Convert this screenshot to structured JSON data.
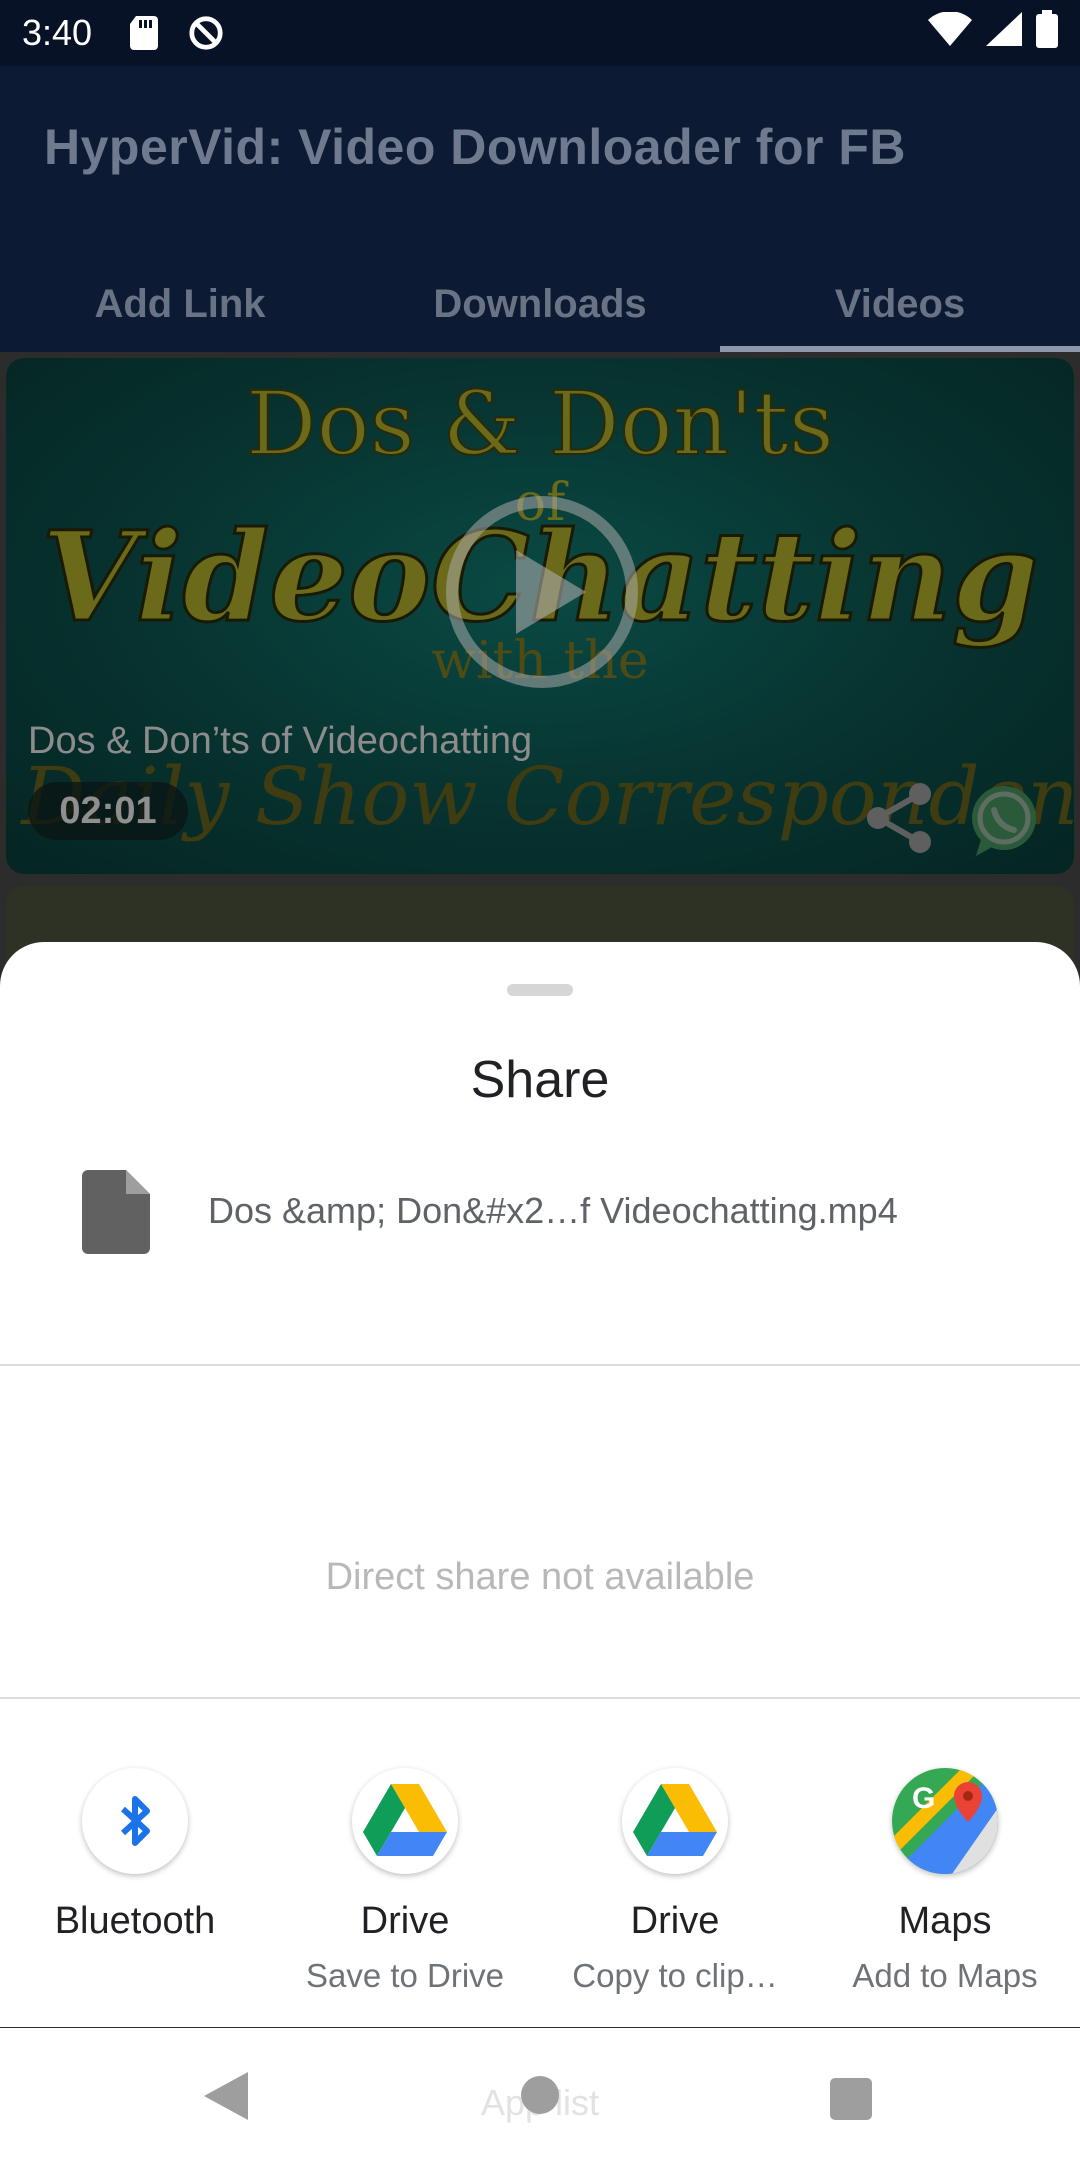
{
  "status_bar": {
    "time": "3:40",
    "icons_left": [
      "sd-card-icon",
      "vpn-icon"
    ],
    "icons_right": [
      "wifi-icon",
      "signal-icon",
      "battery-icon"
    ]
  },
  "app": {
    "title": "HyperVid: Video Downloader for FB",
    "tabs": [
      {
        "label": "Add Link",
        "active": false
      },
      {
        "label": "Downloads",
        "active": false
      },
      {
        "label": "Videos",
        "active": true
      }
    ],
    "video": {
      "thumbnail_text": [
        "Dos & Don'ts",
        "of",
        "VideoChatting",
        "with the",
        "Daily Show Correspondent"
      ],
      "caption": "Dos & Don’ts of Videochatting",
      "duration": "02:01"
    }
  },
  "share_sheet": {
    "title": "Share",
    "file_name": "Dos &amp; Don&#x2…f Videochatting.mp4",
    "direct_share_message": "Direct share not available",
    "targets": [
      {
        "label": "Bluetooth",
        "sub": "",
        "icon": "bluetooth-icon"
      },
      {
        "label": "Drive",
        "sub": "Save to Drive",
        "icon": "drive-icon"
      },
      {
        "label": "Drive",
        "sub": "Copy to clip…",
        "icon": "drive-icon"
      },
      {
        "label": "Maps",
        "sub": "Add to Maps",
        "icon": "maps-icon"
      }
    ]
  },
  "nav_bar": {
    "app_list_label": "App list"
  },
  "colors": {
    "status_bar": "#081226",
    "app_bar": "#0c1a33",
    "sheet": "#ffffff",
    "bluetooth": "#1a73e8"
  }
}
